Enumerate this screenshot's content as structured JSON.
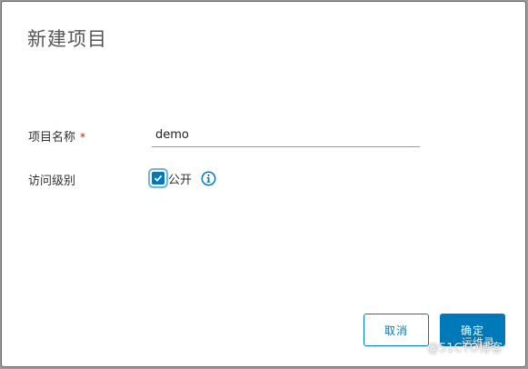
{
  "dialog": {
    "title": "新建项目",
    "fields": {
      "project_name": {
        "label": "项目名称",
        "required_mark": "*",
        "value": "demo"
      },
      "access_level": {
        "label": "访问级别",
        "checkbox_label": "公开",
        "checked": true,
        "info_icon": "info-circle-icon"
      }
    },
    "buttons": {
      "cancel": "取消",
      "ok": "确定"
    }
  },
  "watermark": {
    "top": "运维录",
    "bottom": "@51CTO博客"
  },
  "colors": {
    "primary": "#0079b8",
    "required": "#c92100",
    "title": "#565656"
  }
}
